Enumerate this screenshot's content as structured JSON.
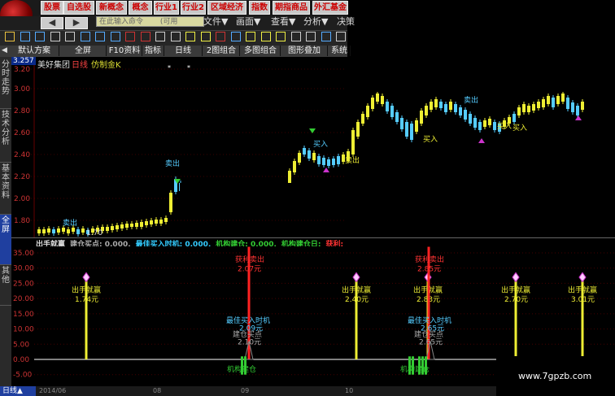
{
  "top_menu": {
    "buttons": [
      "股票",
      "自选股",
      "新概念",
      "概念",
      "行业1",
      "行业2",
      "区域经济",
      "指数",
      "期指商品",
      "外汇基金"
    ],
    "command_placeholder": "在此输入命令",
    "command_hint": "(可用",
    "menus": [
      "文件▼",
      "画面▼",
      "查看▼",
      "分析▼",
      "决策"
    ]
  },
  "tabs": [
    "默认方案",
    "全屏",
    "F10资料",
    "指标",
    "日线",
    "2图组合",
    "多图组合",
    "图形叠加",
    "系统"
  ],
  "side_tabs": [
    "分时走势",
    "技术分析",
    "基本资料",
    "全屏",
    "其他"
  ],
  "price_panel": {
    "stock_name": "美好集团",
    "period": "日线",
    "formula": "仿制金K",
    "current_price_label": "3.257",
    "y_ticks": [
      "3.20",
      "3.00",
      "2.80",
      "2.60",
      "2.40",
      "2.20",
      "2.00",
      "1.80"
    ],
    "low_label": "1.70",
    "annotations": [
      "卖出",
      "卖出",
      "买入",
      "卖出",
      "买入",
      "卖出",
      "买入",
      "买入"
    ]
  },
  "ind_panel": {
    "header": [
      {
        "text": "出手就赢",
        "color": "#dddddd"
      },
      {
        "text": "建仓买点: 0.000,",
        "color": "#aaaaaa"
      },
      {
        "text": "最佳买入时机: 0.000,",
        "color": "#33ccff"
      },
      {
        "text": "机构建仓: 0.000,",
        "color": "#33cc33"
      },
      {
        "text": "机构建仓日:",
        "color": "#33cc33"
      },
      {
        "text": "获利:",
        "color": "#ff3333"
      }
    ],
    "y_ticks": [
      "35.00",
      "30.00",
      "25.00",
      "20.00",
      "15.00",
      "10.00",
      "5.00",
      "0.00",
      "-5.00"
    ],
    "win_labels": [
      {
        "t": "出手就赢",
        "v": "1.74元"
      },
      {
        "t": "出手就赢",
        "v": "2.40元"
      },
      {
        "t": "出手就赢",
        "v": "2.83元"
      },
      {
        "t": "出手就赢",
        "v": "2.70元"
      },
      {
        "t": "出手就赢",
        "v": "3.01元"
      }
    ],
    "red_labels": [
      {
        "t": "获利卖出",
        "v": "2.07元"
      },
      {
        "t": "获利卖出",
        "v": "2.85元"
      }
    ],
    "best_buy": [
      {
        "t": "最佳买入时机",
        "v": "2.09元"
      },
      {
        "t": "最佳买入时机",
        "v": "2.65元"
      }
    ],
    "build_buy": [
      {
        "t": "建仓买点",
        "v": "2.10元"
      },
      {
        "t": "建仓买点",
        "v": "2.65元"
      }
    ],
    "inst_build": [
      "机构建仓",
      "机构建仓"
    ]
  },
  "bottom": {
    "label": "日线▲",
    "dates": [
      "2014/06",
      "08",
      "09",
      "10"
    ]
  },
  "watermark": "www.7gpzb.com"
}
